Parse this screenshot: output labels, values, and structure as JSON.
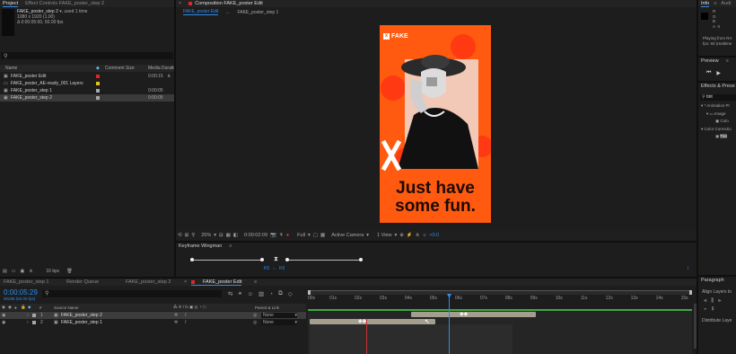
{
  "project_panel": {
    "tab_project": "Project",
    "tab_effect_controls": "Effect Controls FAKE_poster_step 2",
    "selected_name": "FAKE_poster_step 2",
    "used_text": ", used 1 time",
    "dims": "1080 x 1920 (1.00)",
    "duration": "Δ 0:00:05:00, 50.00 fps",
    "columns": {
      "name": "Name",
      "comment": "Comment",
      "size": "Size",
      "media_duration": "Media Duratio"
    },
    "items": [
      {
        "name": "FAKE_poster Edit",
        "color": "#e0262b",
        "duration": "0:00:15"
      },
      {
        "name": "FAKE_poster_AE-ready_001 Layers",
        "color": "#e6c21a",
        "duration": ""
      },
      {
        "name": "FAKE_poster_step 1",
        "color": "#a8a8a8",
        "duration": "0:00:05"
      },
      {
        "name": "FAKE_poster_step 2",
        "color": "#a8a8a8",
        "duration": "0:00:05"
      }
    ],
    "bit_depth": "16 bpc"
  },
  "composition": {
    "tab_title": "Composition FAKE_poster Edit",
    "subtabs": [
      "FAKE_poster Edit",
      "FAKE_poster_step 1"
    ],
    "poster": {
      "brand": "FAKE",
      "headline_line1": "Just have",
      "headline_line2": "some fun.",
      "bg_color": "#ff5a0f"
    },
    "footer": {
      "zoom": "25%",
      "timecode": "0:00:02:09",
      "resolution": "Full",
      "camera": "Active Camera",
      "view": "1 View",
      "exposure": "+0.0"
    }
  },
  "keyframe_wingman": {
    "title": "Keyframe Wingman"
  },
  "info_panel": {
    "tab_info": "Info",
    "tab_audio": "Audi",
    "r": "R",
    "g": "G",
    "b": "B",
    "a": "A",
    "a_val": "0",
    "playing_from": "Playing from RA",
    "fps_line": "fps: 50 (realtime"
  },
  "preview_panel": {
    "title": "Preview"
  },
  "effects_panel": {
    "title": "Effects & Prese",
    "search": "tint",
    "items": [
      "* Animation Pr",
      "Image",
      "Colo",
      "Color Correctio",
      "Tint"
    ]
  },
  "paragraph_panel": {
    "title": "Paragraph",
    "align_layers": "Align Layers to",
    "distribute": "Distribute Laye"
  },
  "timeline": {
    "tabs": [
      "FAKE_poster_step 1",
      "Render Queue",
      "FAKE_poster_step 2",
      "FAKE_poster Edit"
    ],
    "active_tab": 3,
    "current_time": "0:00:05:29",
    "frames": "00298 (50.00 fps)",
    "columns": {
      "source_name": "Source Name",
      "parent": "Parent & Link"
    },
    "layers": [
      {
        "num": "1",
        "name": "FAKE_poster_step 2",
        "parent": "None"
      },
      {
        "num": "2",
        "name": "FAKE_poster_step 1",
        "parent": "None"
      }
    ],
    "ruler": [
      "00s",
      "01s",
      "02s",
      "03s",
      "04s",
      "05s",
      "06s",
      "07s",
      "08s",
      "09s",
      "10s",
      "11s",
      "12s",
      "13s",
      "14s",
      "15s"
    ]
  }
}
